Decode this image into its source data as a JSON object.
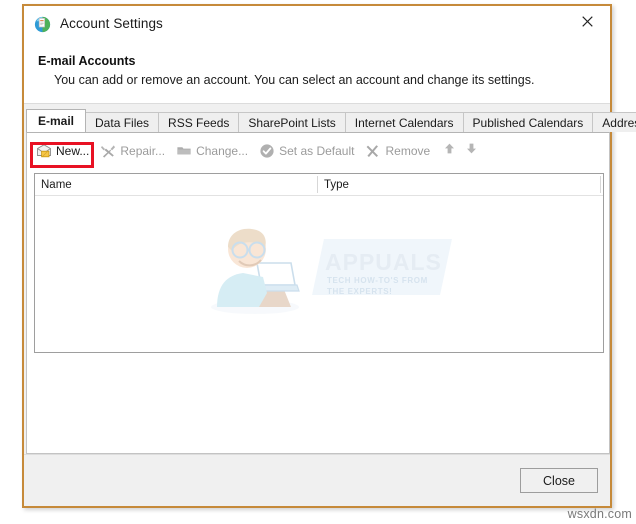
{
  "window": {
    "title": "Account Settings",
    "app_icon": "globe-page-icon",
    "close_icon": "close-icon",
    "border_color": "#c68a3a"
  },
  "header": {
    "title": "E-mail Accounts",
    "description": "You can add or remove an account. You can select an account and change its settings."
  },
  "tabs": [
    {
      "label": "E-mail",
      "active": true
    },
    {
      "label": "Data Files",
      "active": false
    },
    {
      "label": "RSS Feeds",
      "active": false
    },
    {
      "label": "SharePoint Lists",
      "active": false
    },
    {
      "label": "Internet Calendars",
      "active": false
    },
    {
      "label": "Published Calendars",
      "active": false
    },
    {
      "label": "Address Books",
      "active": false
    }
  ],
  "toolbar": {
    "items": [
      {
        "label": "New...",
        "icon": "new-mail-icon",
        "enabled": true,
        "highlighted": true
      },
      {
        "label": "Repair...",
        "icon": "repair-tools-icon",
        "enabled": false,
        "highlighted": false
      },
      {
        "label": "Change...",
        "icon": "change-folder-icon",
        "enabled": false,
        "highlighted": false
      },
      {
        "label": "Set as Default",
        "icon": "check-circle-icon",
        "enabled": false,
        "highlighted": false
      },
      {
        "label": "Remove",
        "icon": "x-remove-icon",
        "enabled": false,
        "highlighted": false
      }
    ],
    "move_up_icon": "arrow-up-icon",
    "move_down_icon": "arrow-down-icon",
    "highlight_color": "#e81123"
  },
  "account_list": {
    "columns": [
      {
        "label": "Name"
      },
      {
        "label": "Type"
      },
      {
        "label": ""
      }
    ],
    "rows": [],
    "empty": true
  },
  "watermark": {
    "brand": "APPUALS",
    "tagline": "TECH HOW-TO'S FROM THE EXPERTS!",
    "brand_color": "#c8d7e6"
  },
  "footer": {
    "close_label": "Close"
  },
  "page_watermark": {
    "text": "wsxdn.com"
  }
}
